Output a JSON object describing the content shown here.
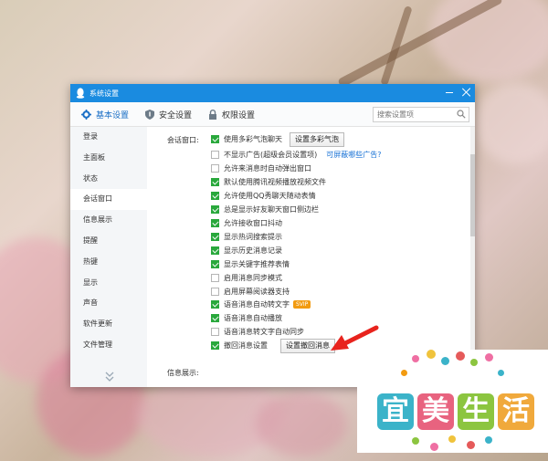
{
  "window": {
    "title": "系统设置"
  },
  "tabs": [
    {
      "label": "基本设置"
    },
    {
      "label": "安全设置"
    },
    {
      "label": "权限设置"
    }
  ],
  "search": {
    "placeholder": "搜索设置项"
  },
  "sidebar": {
    "items": [
      {
        "label": "登录"
      },
      {
        "label": "主面板"
      },
      {
        "label": "状态"
      },
      {
        "label": "会话窗口"
      },
      {
        "label": "信息展示"
      },
      {
        "label": "提醒"
      },
      {
        "label": "热键"
      },
      {
        "label": "显示"
      },
      {
        "label": "声音"
      },
      {
        "label": "软件更新"
      },
      {
        "label": "文件管理"
      }
    ],
    "active_index": 3
  },
  "content": {
    "section_label": "会话窗口:",
    "next_section_label": "信息展示:",
    "options": [
      {
        "label": "使用多彩气泡聊天",
        "checked": true,
        "button": "设置多彩气泡"
      },
      {
        "label": "不显示广告(超级会员设置项)",
        "checked": false,
        "link": "可屏蔽哪些广告?"
      },
      {
        "label": "允许来消息时自动弹出窗口",
        "checked": false
      },
      {
        "label": "默认使用腾讯视频播放视频文件",
        "checked": true
      },
      {
        "label": "允许使用QQ秀聊天随动表情",
        "checked": true
      },
      {
        "label": "总是显示好友聊天窗口侧边栏",
        "checked": true
      },
      {
        "label": "允许接收窗口抖动",
        "checked": true
      },
      {
        "label": "显示热词搜索提示",
        "checked": true
      },
      {
        "label": "显示历史消息记录",
        "checked": true
      },
      {
        "label": "显示关键字推荐表情",
        "checked": true
      },
      {
        "label": "启用消息同步模式",
        "checked": false
      },
      {
        "label": "启用屏幕阅读器支持",
        "checked": false
      },
      {
        "label": "语音消息自动转文字",
        "checked": true,
        "badge": "SVIP"
      },
      {
        "label": "语音消息自动播放",
        "checked": true
      },
      {
        "label": "语音消息转文字自动同步",
        "checked": false
      },
      {
        "label": "撤回消息设置",
        "checked": true,
        "button": "设置撤回消息"
      }
    ]
  },
  "logo": {
    "chars": [
      "宜",
      "美",
      "生",
      "活"
    ]
  },
  "colors": {
    "titlebar": "#1a8be0",
    "accent": "#1a6fc6",
    "checkbox_on": "#29a83c",
    "arrow": "#e8231d"
  }
}
